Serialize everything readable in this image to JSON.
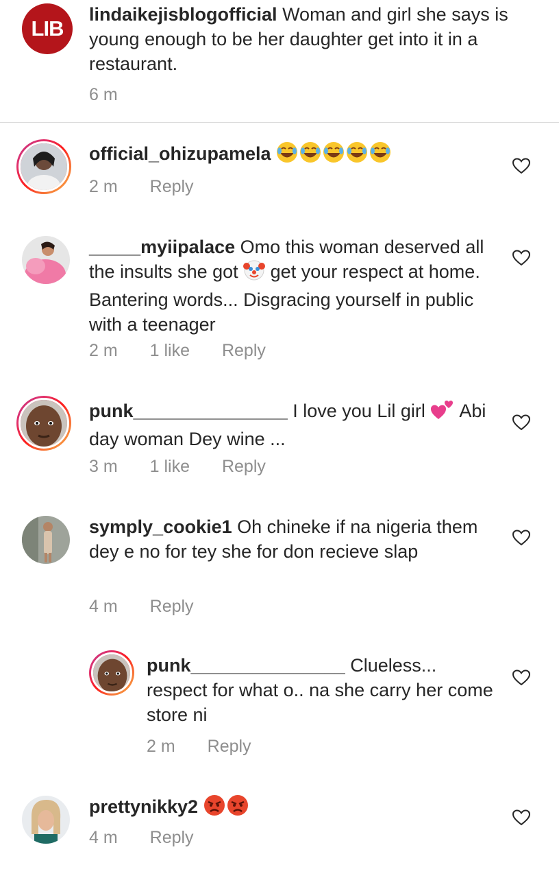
{
  "caption": {
    "username": "lindaikejisblogofficial",
    "text": " Woman and girl she says is young enough to be her daughter get into it in a restaurant.",
    "time": "6 m",
    "logo_text": "LIB"
  },
  "comments": [
    {
      "username": "official_ohizupamela",
      "text": "",
      "emoji": "face-with-tears-of-joy x5",
      "time": "2 m",
      "likes": "",
      "reply": "Reply"
    },
    {
      "username": "_____myiipalace",
      "text": " Omo this woman deserved all the insults she got",
      "text2": " get your respect at home. Bantering words... Disgracing yourself in public with a teenager",
      "emoji": "clown-face",
      "time": "2 m",
      "likes": "1 like",
      "reply": "Reply"
    },
    {
      "username": "punk_______________",
      "text": " I love you Lil girl",
      "text2": " Abi day woman Dey wine ...",
      "emoji": "two-hearts",
      "time": "3 m",
      "likes": "1 like",
      "reply": "Reply"
    },
    {
      "username": "symply_cookie1",
      "text": " Oh chineke if na nigeria them dey e no for tey she for don recieve slap",
      "time": "4 m",
      "likes": "",
      "reply": "Reply"
    },
    {
      "username": "punk_______________",
      "text": " Clueless... respect for what o.. na she carry her come store ni",
      "time": "2 m",
      "likes": "",
      "reply": "Reply"
    },
    {
      "username": "prettynikky2",
      "text": "",
      "emoji": "angry-face x2",
      "time": "4 m",
      "likes": "",
      "reply": "Reply"
    }
  ],
  "icons": {
    "heart": "heart-outline-icon",
    "like_color": "#262626",
    "muted_color": "#8e8e8e"
  }
}
